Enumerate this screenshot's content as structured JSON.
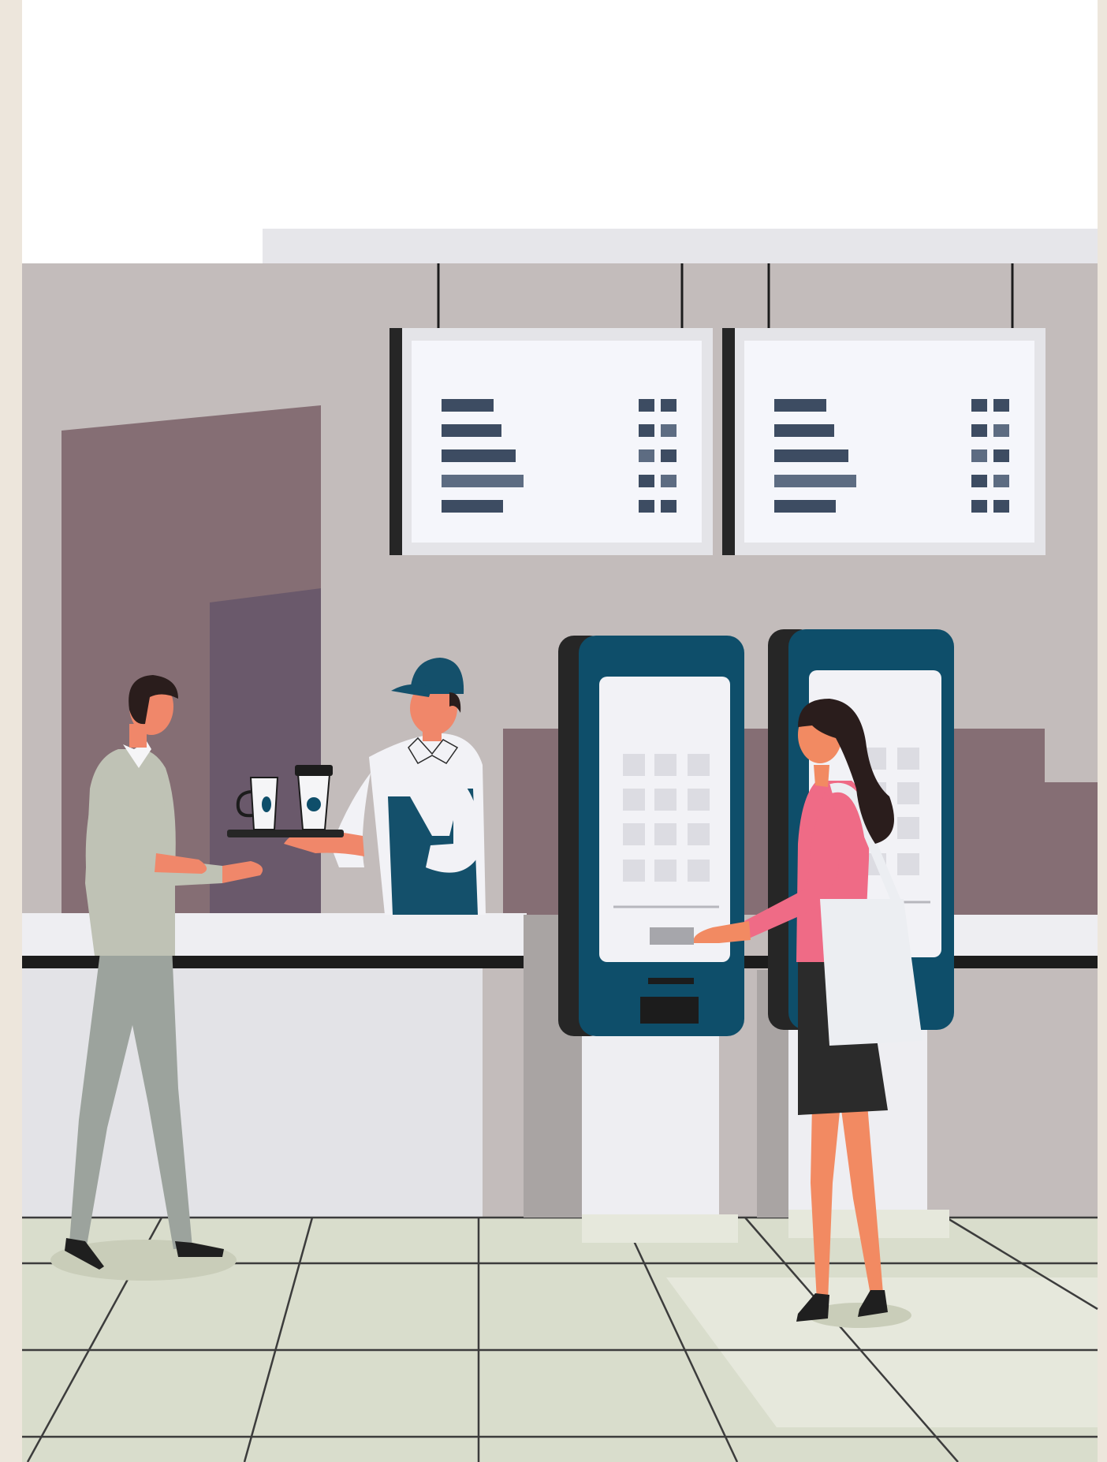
{
  "scene": {
    "description_visible_text": "",
    "colors": {
      "frame": "#ede6dc",
      "sky": "#ffffff",
      "ceiling": "#e6e6ea",
      "wall": "#c3bcbb",
      "mauve": "#856e74",
      "purple": "#6a596b",
      "counter_top": "#eeeef2",
      "counter_front": "#e3e3e7",
      "counter_stripe": "#1c1c1c",
      "floor": "#d9ddcc",
      "floor_light": "#e6e8dc",
      "floor_line": "#3c3c3c",
      "kiosk_body": "#0e4e6a",
      "kiosk_side": "#262626",
      "kiosk_screen": "#f2f2f6",
      "kiosk_button": "#dcdce2",
      "board_frame": "#e4e4e8",
      "board_screen": "#f5f6fb",
      "menu_bar": "#3d4c62",
      "menu_bar_light": "#5d6c82",
      "skin": "#f28a62",
      "skin_man": "#f0876a",
      "hair": "#2a1d1c",
      "man_sweater": "#bfc2b5",
      "man_pants": "#9ca39d",
      "worker_apron": "#14506b",
      "worker_shirt": "#f2f2f6",
      "woman_top": "#ef6b86",
      "woman_skirt": "#2b2b2b",
      "bag": "#eceef2",
      "shoe": "#1f1f1f",
      "shadow": "#c9cdb9"
    },
    "elements": {
      "menu_boards": 2,
      "kiosks": 2,
      "people": [
        "man-customer",
        "barista",
        "woman-customer"
      ],
      "items": [
        "coffee-mug",
        "takeaway-cup",
        "serving-tray",
        "tote-bag",
        "payment-card"
      ]
    }
  }
}
